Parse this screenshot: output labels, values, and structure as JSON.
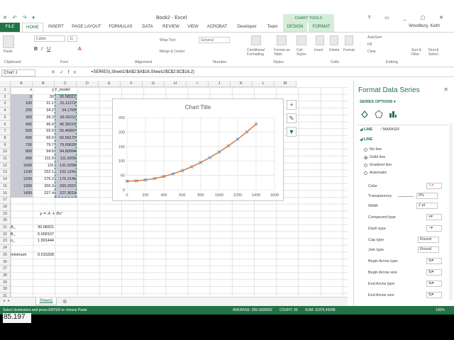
{
  "titlebar": {
    "title": "Book2 - Excel",
    "qat": "✕ ↶ ↷ ▾",
    "window_buttons": "? ▭ _ ▢ ✕"
  },
  "chart_tools_label": "CHART TOOLS",
  "tabs": [
    "FILE",
    "HOME",
    "INSERT",
    "PAGE LAYOUT",
    "FORMULAS",
    "DATA",
    "REVIEW",
    "VIEW",
    "ACROBAT",
    "Developer",
    "Team",
    "DESIGN",
    "FORMAT"
  ],
  "user": "Woodbury, Keith",
  "ribbon": {
    "groups": [
      "Clipboard",
      "Font",
      "Alignment",
      "Number",
      "Styles",
      "Cells",
      "Editing"
    ],
    "paste": "Paste",
    "font_name": "Calibri",
    "font_size": "11",
    "wrap_text": "Wrap Text",
    "merge_center": "Merge & Center",
    "number_format": "General",
    "cond_format": "Conditional Formatting",
    "format_table": "Format as Table",
    "cell_styles": "Cell Styles",
    "insert": "Insert",
    "delete": "Delete",
    "format": "Format",
    "autosum": "AutoSum",
    "fill": "Fill",
    "clear": "Clear",
    "sort_filter": "Sort & Filter",
    "find_select": "Find & Select"
  },
  "formula_bar": {
    "name_box": "Chart 1",
    "formula": "=SERIES(,Sheet1!$A$2:$A$16,Sheet1!$C$2:$C$16,2)"
  },
  "columns": [
    "A",
    "B",
    "C",
    "D",
    "E",
    "F",
    "G",
    "H",
    "I",
    "J",
    "K",
    "L",
    "M"
  ],
  "rows": [
    "1",
    "2",
    "3",
    "4",
    "5",
    "6",
    "7",
    "8",
    "9",
    "10",
    "11",
    "12",
    "13",
    "14",
    "15",
    "16",
    "17",
    "18",
    "19",
    "20",
    "21",
    "22",
    "23",
    "24",
    "25",
    "26",
    "27",
    "28",
    "29",
    "30",
    "31"
  ],
  "sheet": {
    "headers": {
      "x": "x",
      "y": "y",
      "y_model": "Y_model"
    },
    "x": [
      "0",
      "100",
      "200",
      "300",
      "400",
      "500",
      "600",
      "700",
      "800",
      "900",
      "1000",
      "1100",
      "1200",
      "1300",
      "1400"
    ],
    "y": [
      "30",
      "31.1",
      "34.2",
      "39.3",
      "46.4",
      "55.5",
      "66.6",
      "79.7",
      "94.8",
      "111.9",
      "131",
      "152.1",
      "175.2",
      "200.3",
      "227.4"
    ],
    "y_model": [
      "30.08321",
      "31.11272",
      "34.1769",
      "39.26211",
      "46.36315",
      "55.46897",
      "66.58172",
      "79.69626",
      "94.80994",
      "111.9205",
      "131.0258",
      "152.1242",
      "175.2146",
      "200.2937",
      "227.3619"
    ],
    "equation": "y = A + Bxⁿ",
    "params": [
      {
        "name": "A_",
        "value": "30.08321"
      },
      {
        "name": "B_",
        "value": "0.000107"
      },
      {
        "name": "n_",
        "value": "1.991444"
      }
    ],
    "minimum_label": "minimum",
    "minimum_value": "0.015328"
  },
  "chart_data": {
    "type": "scatter",
    "title": "Chart Title",
    "xlabel": "",
    "ylabel": "",
    "xlim": [
      0,
      1600
    ],
    "ylim": [
      0,
      250
    ],
    "xticks": [
      "0",
      "200",
      "400",
      "600",
      "800",
      "1000",
      "1200",
      "1400",
      "1600"
    ],
    "yticks": [
      "0",
      "50",
      "100",
      "150",
      "200",
      "250"
    ],
    "grid": true,
    "x": [
      0,
      100,
      200,
      300,
      400,
      500,
      600,
      700,
      800,
      900,
      1000,
      1100,
      1200,
      1300,
      1400
    ],
    "series": [
      {
        "values": [
          30,
          31.1,
          34.2,
          39.3,
          46.4,
          55.5,
          66.6,
          79.7,
          94.8,
          111.9,
          131,
          152.1,
          175.2,
          200.3,
          227.4
        ],
        "color": "#5B9BD5",
        "marker": "x"
      },
      {
        "values": [
          30.08,
          31.11,
          34.18,
          39.26,
          46.36,
          55.47,
          66.58,
          79.7,
          94.81,
          111.92,
          131.03,
          152.12,
          175.21,
          200.29,
          227.36
        ],
        "color": "#ED7D31",
        "marker": "line"
      }
    ]
  },
  "pane": {
    "title": "Format Data Series",
    "subtitle": "SERIES OPTIONS ▾",
    "tab_line": "LINE",
    "tab_marker": "MARKER",
    "section": "LINE",
    "options": [
      "No line",
      "Solid line",
      "Gradient line",
      "Automatic"
    ],
    "color_label": "Color",
    "transparency_label": "Transparency",
    "transparency_value": "0%",
    "width_label": "Width",
    "width_value": "2 pt",
    "compound_label": "Compound type",
    "dash_label": "Dash type",
    "cap_label": "Cap type",
    "cap_value": "Round",
    "join_label": "Join type",
    "join_value": "Round",
    "begin_arrow_type": "Begin Arrow type",
    "begin_arrow_size": "Begin Arrow size",
    "end_arrow_type": "End Arrow type",
    "end_arrow_size": "End Arrow size"
  },
  "sheet_tab": "Sheet1",
  "status": {
    "message": "Select destination and press ENTER or choose Paste",
    "average": "AVERAGE: 399.1830992",
    "count": "COUNT: 30",
    "sum": "SUM: 11975.49298",
    "zoom": "100%"
  },
  "overlay_text": "85.197"
}
